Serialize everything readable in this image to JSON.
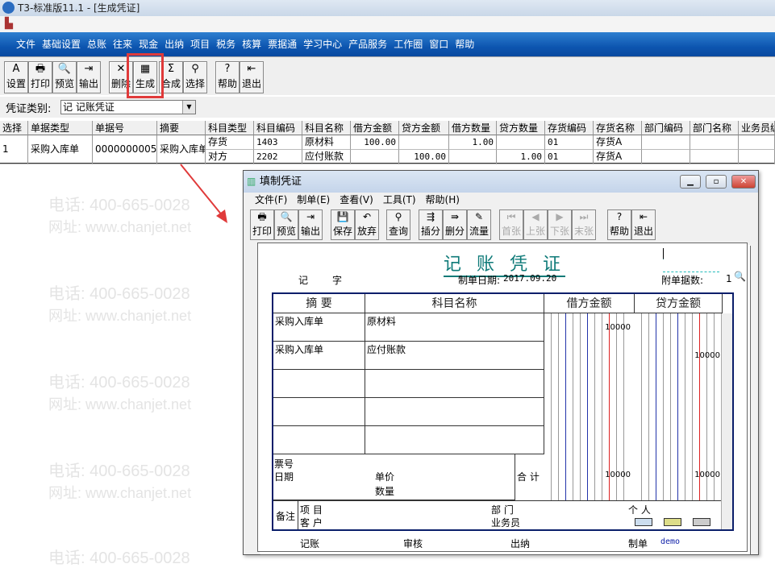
{
  "app": {
    "title": "T3-标准版11.1 - [生成凭证]"
  },
  "watermark": {
    "phone": "电话: 400-665-0028",
    "site": "网址: www.chanjet.net"
  },
  "menu": [
    "文件",
    "基础设置",
    "总账",
    "往来",
    "现金",
    "出纳",
    "项目",
    "税务",
    "核算",
    "票据通",
    "学习中心",
    "产品服务",
    "工作圈",
    "窗口",
    "帮助"
  ],
  "toolbar": [
    {
      "label": "设置",
      "icon": "A"
    },
    {
      "label": "打印",
      "icon": "🖶"
    },
    {
      "label": "预览",
      "icon": "🔍"
    },
    {
      "label": "输出",
      "icon": "⇥"
    },
    {
      "label": "删除",
      "icon": "✕"
    },
    {
      "label": "生成",
      "icon": "▦"
    },
    {
      "label": "合成",
      "icon": "Σ"
    },
    {
      "label": "选择",
      "icon": "⚲"
    },
    {
      "label": "帮助",
      "icon": "?"
    },
    {
      "label": "退出",
      "icon": "⇤"
    }
  ],
  "voucher_type": {
    "label": "凭证类别:",
    "value": "记 记账凭证"
  },
  "grid": {
    "columns": [
      "选择",
      "单据类型",
      "单据号",
      "摘要",
      "科目类型",
      "科目编码",
      "科目名称",
      "借方金额",
      "贷方金额",
      "借方数量",
      "贷方数量",
      "存货编码",
      "存货名称",
      "部门编码",
      "部门名称",
      "业务员编"
    ],
    "row": {
      "select": "1",
      "doc_type": "采购入库单",
      "doc_no": "0000000005",
      "summary": "采购入库单",
      "lines": [
        {
          "acct_type": "存货",
          "acct_code": "1403",
          "acct_name": "原材料",
          "debit": "100.00",
          "credit": "",
          "debit_qty": "1.00",
          "credit_qty": "",
          "inv_code": "01",
          "inv_name": "存货A"
        },
        {
          "acct_type": "对方",
          "acct_code": "2202",
          "acct_name": "应付账款",
          "debit": "",
          "credit": "100.00",
          "debit_qty": "",
          "credit_qty": "1.00",
          "inv_code": "01",
          "inv_name": "存货A"
        }
      ]
    }
  },
  "dialog": {
    "title": "填制凭证",
    "menu": [
      "文件(F)",
      "制单(E)",
      "查看(V)",
      "工具(T)",
      "帮助(H)"
    ],
    "toolbar": [
      "打印",
      "预览",
      "输出",
      "保存",
      "放弃",
      "查询",
      "插分",
      "删分",
      "流量",
      "首张",
      "上张",
      "下张",
      "末张",
      "帮助",
      "退出"
    ],
    "voucher": {
      "title": "记 账 凭 证",
      "type_char": "记",
      "zi": "字",
      "date_label": "制单日期:",
      "date": "2017.09.20",
      "attach_label": "附单据数:",
      "attach_count": "1",
      "headers": [
        "摘 要",
        "科目名称",
        "借方金额",
        "贷方金额"
      ],
      "entries": [
        {
          "summary": "采购入库单",
          "account": "原材料",
          "debit": "10000",
          "credit": ""
        },
        {
          "summary": "采购入库单",
          "account": "应付账款",
          "debit": "",
          "credit": "10000"
        }
      ],
      "ticket_label": "票号",
      "date_field": "日期",
      "unit_price": "单价",
      "quantity": "数量",
      "total_label": "合 计",
      "total_debit": "10000",
      "total_credit": "10000",
      "remark": "备注",
      "project": "项 目",
      "customer": "客 户",
      "dept": "部 门",
      "salesman": "业务员",
      "person": "个 人",
      "sign": {
        "bookkeep": "记账",
        "audit": "审核",
        "cashier": "出纳",
        "maker": "制单",
        "maker_name": "demo"
      }
    }
  }
}
